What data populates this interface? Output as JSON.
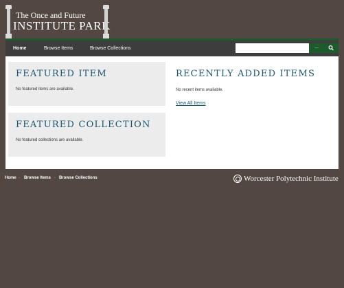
{
  "site": {
    "title_line1": "The Once and Future",
    "title_line2": "INSTITUTE PARK"
  },
  "nav": {
    "items": [
      {
        "label": "Home",
        "active": true
      },
      {
        "label": "Browse Items",
        "active": false
      },
      {
        "label": "Browse Collections",
        "active": false
      }
    ],
    "search": {
      "value": "",
      "placeholder": "",
      "advanced_label": "...",
      "submit_icon": "search-icon"
    }
  },
  "featured_item": {
    "heading": "FEATURED ITEM",
    "message": "No featured items are available."
  },
  "featured_collection": {
    "heading": "FEATURED COLLECTION",
    "message": "No featured collections are available."
  },
  "recent": {
    "heading": "RECENTLY ADDED ITEMS",
    "message": "No recent items available.",
    "view_all": "View All Items"
  },
  "footer": {
    "links": [
      "Home",
      "Browse Items",
      "Browse Collections"
    ],
    "separator": "·",
    "institution": "Worcester Polytechnic Institute"
  },
  "colors": {
    "page_background": "#524741",
    "nav_background": "#3d3d3d",
    "accent_green": "#1c5b2c",
    "heading_blue": "#1a5673",
    "box_background": "#ececec"
  }
}
